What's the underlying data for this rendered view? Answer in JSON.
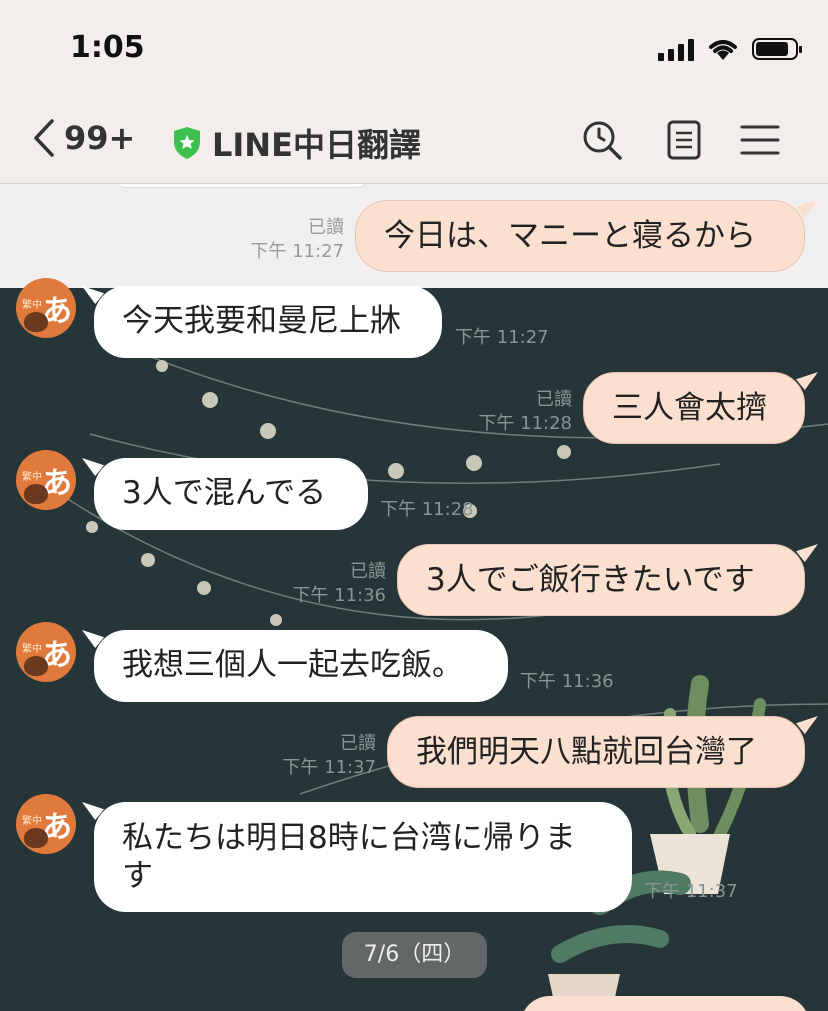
{
  "status": {
    "time": "1:05"
  },
  "header": {
    "back_count": "99+",
    "title": "LINE中日翻譯"
  },
  "messages": [
    {
      "side": "out",
      "text": "今日は、マニーと寝るから",
      "read": "已讀",
      "time": "下午 11:27"
    },
    {
      "side": "in",
      "text": "今天我要和曼尼上牀",
      "time": "下午 11:27"
    },
    {
      "side": "out",
      "text": "三人會太擠",
      "read": "已讀",
      "time": "下午 11:28"
    },
    {
      "side": "in",
      "text": "3人で混んでる",
      "time": "下午 11:28"
    },
    {
      "side": "out",
      "text": "3人でご飯行きたいです",
      "read": "已讀",
      "time": "下午 11:36"
    },
    {
      "side": "in",
      "text": "我想三個人一起去吃飯。",
      "time": "下午 11:36"
    },
    {
      "side": "out",
      "text": "我們明天八點就回台灣了",
      "read": "已讀",
      "time": "下午 11:37"
    },
    {
      "side": "in",
      "text": "私たちは明日8時に台湾に帰ります",
      "time": "下午 11:37"
    }
  ],
  "avatar": {
    "kana": "あ",
    "badge": "繁中"
  },
  "date_divider": "7/6（四）",
  "colors": {
    "outgoing": "#fbe0d0",
    "incoming": "#ffffff",
    "avatar": "#e07a3c",
    "chat_bg": "#263638",
    "shield": "#3fbf4b"
  },
  "icons": [
    "back-chevron-icon",
    "shield-star-icon",
    "search-icon",
    "notes-icon",
    "menu-icon",
    "signal-icon",
    "wifi-icon",
    "battery-icon"
  ]
}
